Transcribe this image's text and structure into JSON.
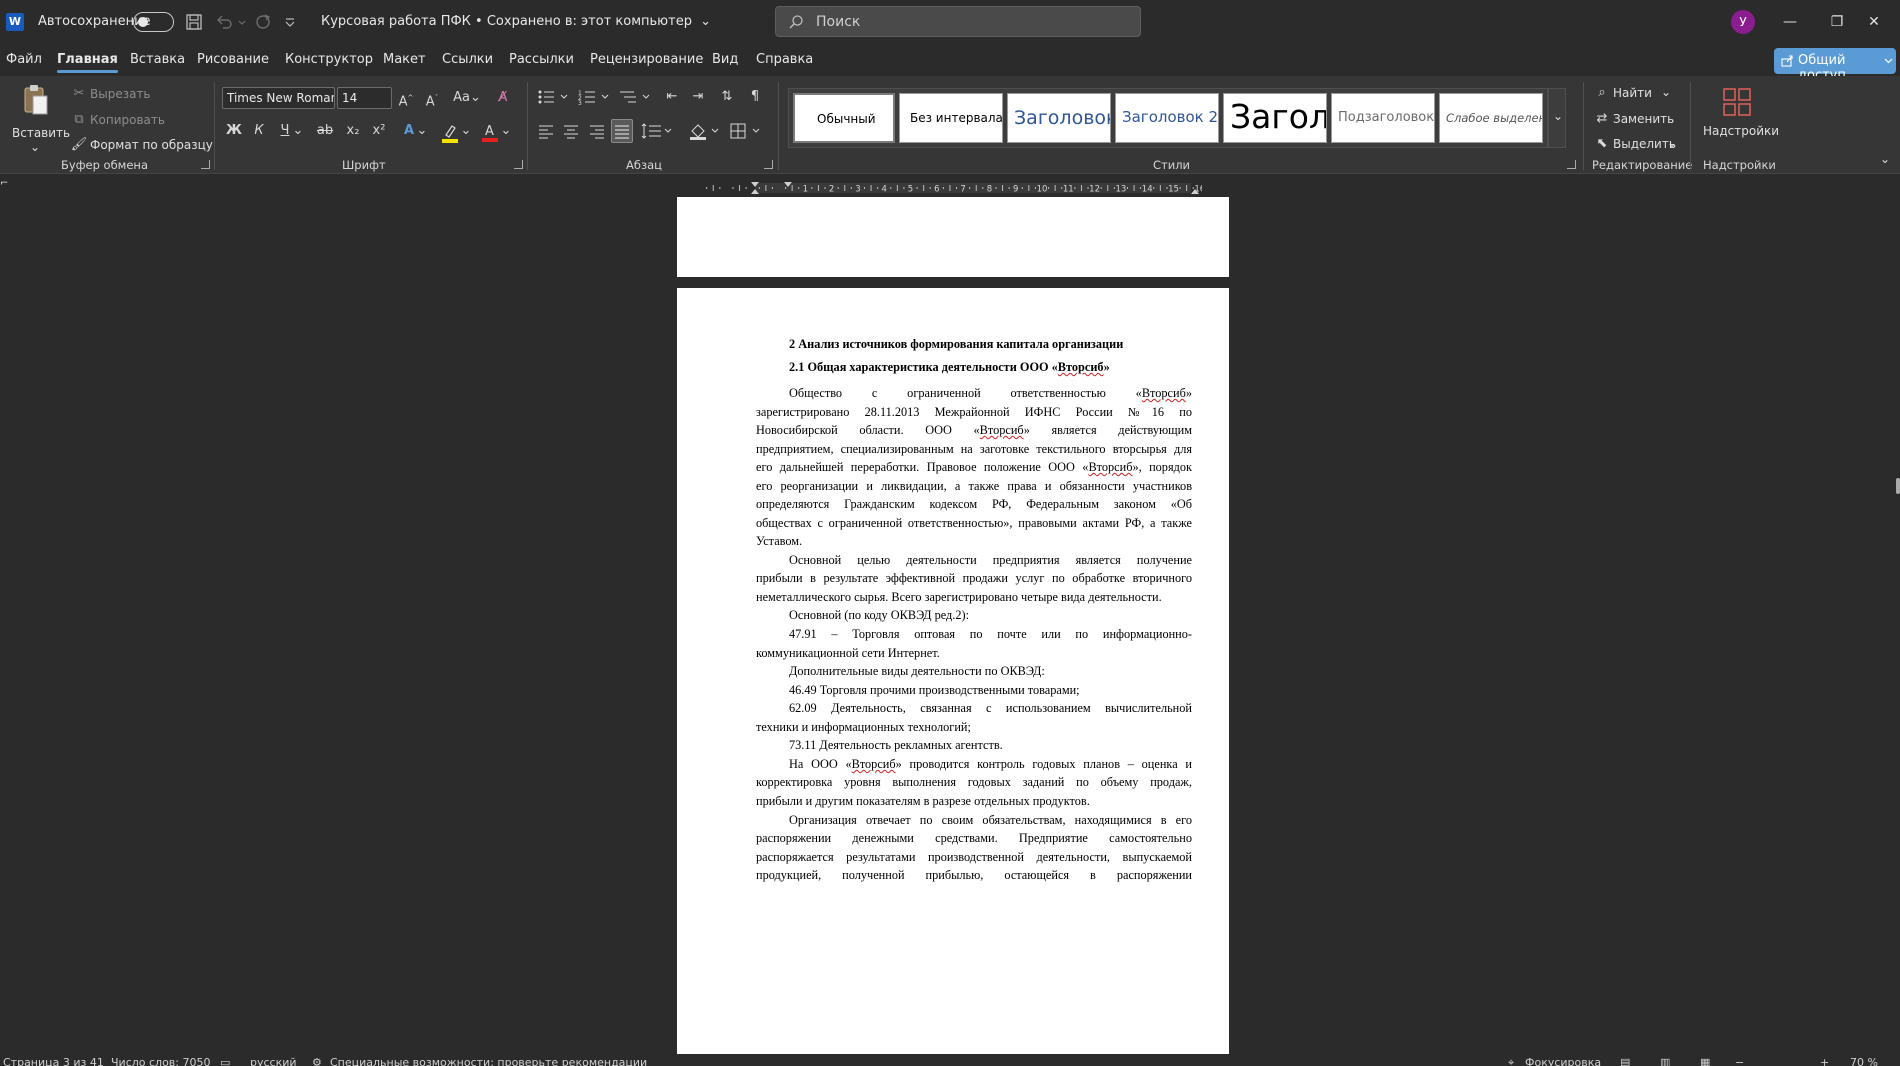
{
  "titlebar": {
    "autosave_label": "Автосохранение",
    "doc_title": "Курсовая работа ПФК • Сохранено в: этот компьютер",
    "search_placeholder": "Поиск",
    "avatar_letter": "У",
    "app_icon": "word-logo-icon"
  },
  "menu": {
    "tabs": [
      "Файл",
      "Главная",
      "Вставка",
      "Рисование",
      "Конструктор",
      "Макет",
      "Ссылки",
      "Рассылки",
      "Рецензирование",
      "Вид",
      "Справка"
    ],
    "active": "Главная",
    "share_label": "Общий доступ"
  },
  "ribbon": {
    "clipboard": {
      "paste": "Вставить",
      "cut": "Вырезать",
      "copy": "Копировать",
      "format_painter": "Формат по образцу",
      "label": "Буфер обмена"
    },
    "font": {
      "name": "Times New Roman",
      "size": "14",
      "bold": "Ж",
      "italic": "К",
      "underline": "Ч",
      "label": "Шрифт"
    },
    "paragraph": {
      "label": "Абзац"
    },
    "styles": {
      "items": [
        "Обычный",
        "Без интервала",
        "Заголовок",
        "Заголовок 2",
        "Заголовок",
        "Подзаголовок",
        "Слабое выделение"
      ],
      "label": "Стили"
    },
    "editing": {
      "find": "Найти",
      "replace": "Заменить",
      "select": "Выделить",
      "label": "Редактирование"
    },
    "addins": {
      "button": "Надстройки",
      "label": "Надстройки"
    }
  },
  "document": {
    "heading1": "2 Анализ источников формирования капитала организации",
    "heading2": "2.1 Общая характеристика деятельности ООО «Вторсиб»",
    "lines": [
      "Общество с ограниченной ответственностью «Вторсиб»",
      "зарегистрировано 28.11.2013 Межрайонной ИФНС России №16 по",
      "Новосибирской области. ООО «Вторсиб» является действующим",
      "предприятием, специализированным на заготовке текстильного вторсырья для",
      "его дальнейшей переработки. Правовое положение ООО «Вторсиб», порядок",
      "его реорганизации и ликвидации, а также права и обязанности участников",
      "определяются Гражданским кодексом РФ, Федеральным законом «Об",
      "обществах с ограниченной ответственностью», правовыми актами РФ, а также",
      "Уставом.",
      "Основной целью деятельности предприятия является получение",
      "прибыли в результате эффективной продажи услуг по обработке вторичного",
      "неметаллического сырья. Всего зарегистрировано четыре вида деятельности.",
      "Основной (по коду ОКВЭД ред.2):",
      "47.91 – Торговля оптовая по почте или по информационно-",
      "коммуникационной сети Интернет.",
      "Дополнительные виды деятельности по ОКВЭД:",
      "46.49 Торговля прочими производственными товарами;",
      "62.09 Деятельность, связанная с использованием вычислительной",
      "техники и информационных технологий;",
      "73.11 Деятельность рекламных агентств.",
      "На ООО «Вторсиб» проводится контроль годовых планов – оценка и",
      "корректировка уровня выполнения годовых заданий по объему продаж,",
      "прибыли и другим показателям в разрезе отдельных продуктов.",
      "Организация отвечает по своим обязательствам, находящимися в его",
      "распоряжении денежными средствами. Предприятие самостоятельно",
      "распоряжается результатами производственной деятельности, выпускаемой",
      "продукцией, полученной прибылью, остающейся в распоряжении"
    ]
  },
  "statusbar": {
    "page": "Страница 3 из 41",
    "words": "Число слов: 7050",
    "language": "русский",
    "accessibility": "Специальные возможности: проверьте рекомендации",
    "focus": "Фокусировка",
    "zoom": "70 %"
  }
}
